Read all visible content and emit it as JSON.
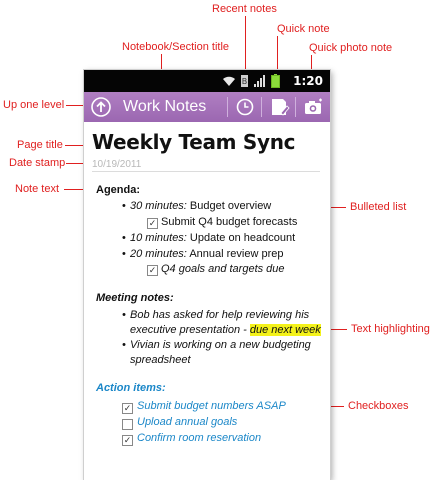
{
  "callouts": {
    "recent_notes": "Recent notes",
    "notebook_section_title": "Notebook/Section title",
    "quick_note": "Quick note",
    "quick_photo_note": "Quick photo note",
    "up_one_level": "Up one level",
    "page_title": "Page title",
    "date_stamp": "Date stamp",
    "note_text": "Note text",
    "bulleted_list": "Bulleted list",
    "text_highlighting": "Text highlighting",
    "checkboxes": "Checkboxes"
  },
  "statusbar": {
    "time": "1:20"
  },
  "actionbar": {
    "title": "Work Notes"
  },
  "page": {
    "title": "Weekly Team Sync",
    "date": "10/19/2011",
    "agenda": {
      "heading": "Agenda:",
      "items": [
        {
          "time": "30 minutes:",
          "text": " Budget overview"
        },
        {
          "sub_checked": true,
          "text": "Submit Q4 budget forecasts"
        },
        {
          "time": "10 minutes:",
          "text": " Update on headcount"
        },
        {
          "time": "20 minutes:",
          "text": " Annual review prep"
        },
        {
          "sub_checked": true,
          "text": "Q4 goals and targets due"
        }
      ]
    },
    "meeting_notes": {
      "heading": "Meeting notes:",
      "b1_line1": "Bob has asked for help reviewing his",
      "b1_line2": "executive presentation - ",
      "b1_highlight": "due next week",
      "b2_line1": "Vivian is working on a new budgeting",
      "b2_line2": "spreadsheet"
    },
    "action_items": {
      "heading": "Action items:",
      "items": [
        {
          "checked": true,
          "text": "Submit budget numbers ASAP"
        },
        {
          "checked": false,
          "text": "Upload annual goals"
        },
        {
          "checked": true,
          "text": "Confirm room reservation"
        }
      ]
    }
  },
  "colors": {
    "accent": "#9b67b1",
    "callout": "#e02020",
    "link_blue": "#1b87c8",
    "highlight": "#f4f21a"
  }
}
